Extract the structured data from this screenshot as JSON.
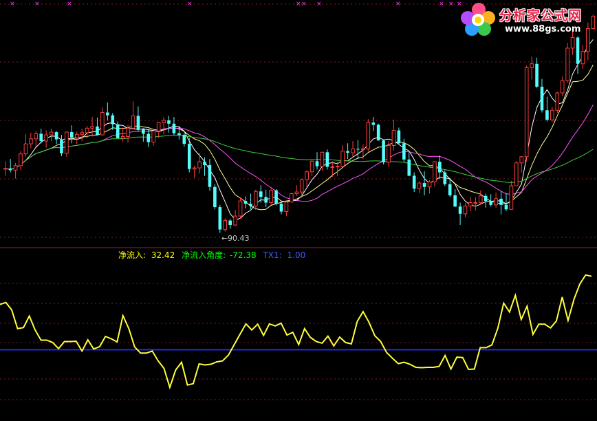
{
  "logo": {
    "title": "分析家公式网",
    "url": "www.88gs.com"
  },
  "annotations": {
    "low_marker": "←90.43"
  },
  "legend": {
    "flow_label": "净流入:",
    "flow_value": "32.42",
    "angle_label": "净流入角度:",
    "angle_value": "-72.38",
    "tx_label": "TX1:",
    "tx_value": "1.00"
  },
  "colors": {
    "background": "#000000",
    "up_candle": "#ff3c3c",
    "down_candle": "#54fcfc",
    "ma5": "#ffffff",
    "ma10": "#ffff9a",
    "ma20": "#ff55ff",
    "ma60": "#3cd23c",
    "osc_line": "#ffff3c",
    "baseline": "#2828ff",
    "grid": "#8a1c1c",
    "flow_label": "#ffff00",
    "angle_label": "#00ff00",
    "tx_label": "#3c5cff"
  },
  "chart_data": [
    {
      "type": "candlestick",
      "title": "",
      "xlabel": "",
      "ylabel": "",
      "ylim": [
        88,
        132
      ],
      "grid": true,
      "annotation_low": 90.43,
      "ohlc": [
        [
          101.8,
          103.2,
          100.6,
          101.9
        ],
        [
          101.9,
          103.6,
          101.2,
          101.6
        ],
        [
          101.6,
          102.9,
          100.1,
          102.4
        ],
        [
          102.4,
          105.0,
          101.6,
          104.5
        ],
        [
          104.5,
          108.0,
          104.0,
          106.3
        ],
        [
          106.3,
          108.3,
          105.5,
          107.2
        ],
        [
          107.2,
          108.6,
          105.8,
          108.1
        ],
        [
          108.1,
          109.0,
          106.4,
          106.8
        ],
        [
          106.8,
          108.7,
          105.6,
          107.9
        ],
        [
          107.9,
          109.0,
          106.8,
          108.4
        ],
        [
          108.4,
          108.6,
          106.3,
          107.1
        ],
        [
          107.1,
          107.9,
          104.1,
          104.6
        ],
        [
          104.6,
          108.5,
          104.0,
          108.4
        ],
        [
          108.4,
          109.6,
          106.4,
          107.4
        ],
        [
          107.4,
          108.5,
          106.3,
          108.0
        ],
        [
          108.0,
          109.0,
          106.8,
          108.3
        ],
        [
          108.3,
          109.5,
          107.3,
          109.1
        ],
        [
          109.1,
          111.1,
          107.6,
          109.4
        ],
        [
          109.4,
          111.0,
          107.8,
          107.9
        ],
        [
          107.9,
          112.8,
          107.8,
          111.9
        ],
        [
          111.9,
          113.7,
          110.5,
          111.4
        ],
        [
          111.4,
          111.8,
          108.8,
          109.8
        ],
        [
          109.8,
          110.3,
          107.3,
          107.3
        ],
        [
          107.3,
          109.2,
          106.7,
          107.6
        ],
        [
          107.6,
          109.7,
          106.5,
          109.1
        ],
        [
          109.1,
          113.9,
          108.9,
          111.3
        ],
        [
          111.3,
          113.0,
          108.5,
          108.9
        ],
        [
          108.9,
          109.1,
          106.7,
          108.1
        ],
        [
          108.1,
          109.0,
          105.7,
          106.6
        ],
        [
          106.6,
          108.6,
          106.0,
          108.6
        ],
        [
          108.6,
          110.2,
          107.3,
          110.1
        ],
        [
          110.1,
          111.1,
          108.0,
          110.5
        ],
        [
          110.5,
          111.3,
          108.3,
          109.9
        ],
        [
          109.9,
          111.1,
          107.9,
          108.2
        ],
        [
          108.2,
          109.5,
          107.1,
          107.9
        ],
        [
          107.9,
          108.2,
          105.8,
          106.3
        ],
        [
          106.3,
          107.3,
          101.2,
          101.8
        ],
        [
          101.8,
          102.4,
          100.2,
          102.0
        ],
        [
          102.0,
          104.6,
          101.0,
          103.1
        ],
        [
          103.1,
          103.9,
          100.6,
          102.5
        ],
        [
          102.5,
          103.6,
          97.9,
          98.6
        ],
        [
          98.6,
          99.1,
          94.6,
          95.0
        ],
        [
          95.0,
          95.4,
          90.4,
          91.0
        ],
        [
          91.0,
          93.0,
          90.6,
          92.6
        ],
        [
          92.6,
          92.9,
          91.1,
          91.8
        ],
        [
          91.8,
          94.5,
          91.6,
          93.4
        ],
        [
          93.4,
          96.6,
          92.9,
          96.1
        ],
        [
          96.1,
          96.9,
          94.8,
          95.6
        ],
        [
          95.6,
          97.4,
          94.6,
          95.2
        ],
        [
          95.2,
          98.1,
          94.5,
          97.8
        ],
        [
          97.8,
          98.9,
          95.8,
          96.8
        ],
        [
          96.8,
          98.1,
          95.0,
          95.8
        ],
        [
          95.8,
          98.6,
          95.4,
          98.0
        ],
        [
          98.0,
          98.2,
          95.3,
          95.6
        ],
        [
          95.6,
          96.0,
          93.7,
          94.2
        ],
        [
          94.2,
          95.9,
          93.4,
          95.9
        ],
        [
          95.9,
          97.6,
          95.8,
          97.4
        ],
        [
          97.4,
          98.9,
          97.0,
          97.7
        ],
        [
          97.7,
          100.0,
          96.7,
          99.9
        ],
        [
          99.9,
          101.6,
          98.6,
          101.3
        ],
        [
          101.3,
          103.4,
          100.5,
          103.2
        ],
        [
          103.2,
          104.8,
          101.7,
          102.3
        ],
        [
          102.3,
          104.9,
          101.5,
          104.8
        ],
        [
          104.8,
          105.3,
          101.7,
          102.2
        ],
        [
          102.2,
          103.2,
          100.4,
          102.2
        ],
        [
          102.2,
          103.0,
          100.5,
          102.3
        ],
        [
          102.3,
          106.1,
          102.2,
          105.0
        ],
        [
          105.0,
          106.4,
          103.6,
          104.7
        ],
        [
          104.7,
          106.8,
          104.0,
          105.4
        ],
        [
          105.4,
          107.0,
          103.6,
          105.3
        ],
        [
          105.3,
          106.2,
          103.6,
          105.4
        ],
        [
          105.4,
          110.7,
          104.9,
          110.1
        ],
        [
          110.1,
          111.1,
          108.6,
          109.7
        ],
        [
          109.7,
          109.9,
          106.9,
          106.9
        ],
        [
          106.9,
          107.0,
          102.6,
          103.0
        ],
        [
          103.0,
          106.8,
          102.2,
          106.0
        ],
        [
          106.0,
          110.6,
          105.1,
          108.7
        ],
        [
          108.7,
          109.2,
          106.2,
          106.4
        ],
        [
          106.4,
          107.2,
          103.1,
          103.5
        ],
        [
          103.5,
          104.8,
          100.5,
          100.6
        ],
        [
          100.6,
          101.2,
          97.7,
          98.3
        ],
        [
          98.3,
          99.6,
          97.5,
          99.3
        ],
        [
          99.3,
          101.4,
          97.1,
          98.6
        ],
        [
          98.6,
          99.8,
          97.4,
          99.5
        ],
        [
          99.5,
          103.2,
          98.7,
          103.1
        ],
        [
          103.1,
          104.2,
          100.0,
          101.2
        ],
        [
          101.2,
          101.6,
          98.8,
          99.1
        ],
        [
          99.1,
          100.2,
          96.8,
          97.1
        ],
        [
          97.1,
          98.2,
          95.0,
          95.1
        ],
        [
          95.1,
          95.8,
          91.8,
          93.8
        ],
        [
          93.8,
          95.7,
          93.2,
          95.2
        ],
        [
          95.2,
          96.8,
          94.3,
          95.8
        ],
        [
          95.8,
          96.8,
          94.4,
          95.8
        ],
        [
          95.8,
          98.0,
          95.4,
          97.0
        ],
        [
          97.0,
          97.4,
          94.9,
          96.1
        ],
        [
          96.1,
          97.3,
          95.1,
          95.4
        ],
        [
          95.4,
          97.6,
          94.9,
          96.5
        ],
        [
          96.5,
          97.8,
          93.7,
          95.4
        ],
        [
          95.4,
          97.5,
          94.3,
          94.6
        ],
        [
          94.6,
          99.7,
          94.6,
          98.8
        ],
        [
          98.8,
          103.2,
          98.8,
          102.9
        ],
        [
          102.9,
          104.1,
          101.2,
          104.0
        ],
        [
          104.0,
          120.3,
          103.1,
          119.9
        ],
        [
          119.9,
          121.9,
          117.8,
          120.6
        ],
        [
          120.6,
          121.7,
          116.3,
          116.5
        ],
        [
          116.5,
          117.9,
          111.9,
          112.3
        ],
        [
          112.3,
          114.7,
          110.3,
          110.6
        ],
        [
          110.6,
          112.9,
          110.2,
          112.3
        ],
        [
          112.3,
          115.6,
          111.8,
          115.4
        ],
        [
          115.4,
          118.3,
          114.8,
          117.6
        ],
        [
          117.6,
          124.3,
          117.2,
          123.4
        ],
        [
          123.4,
          126.8,
          122.2,
          125.3
        ],
        [
          125.3,
          125.5,
          118.8,
          120.6
        ],
        [
          120.6,
          123.9,
          119.7,
          122.8
        ],
        [
          122.8,
          128.0,
          121.2,
          126.9
        ],
        [
          126.9,
          129.4,
          126.7,
          129.1
        ]
      ]
    },
    {
      "type": "line",
      "title": "",
      "xlabel": "",
      "ylabel": "",
      "ylim": [
        -20,
        28
      ],
      "grid": true,
      "series": [
        {
          "name": "净流入",
          "values": [
            14.3,
            14.9,
            12.7,
            7.2,
            7.5,
            10.9,
            6.8,
            3.8,
            3.8,
            3.1,
            1.3,
            3.4,
            3.4,
            3.5,
            0.6,
            3.9,
            1.2,
            1.9,
            4.9,
            4.2,
            3.3,
            11.0,
            7.2,
            1.8,
            0.0,
            0.0,
            0.6,
            -2.3,
            -4.5,
            -10.1,
            -5.0,
            -2.7,
            -9.4,
            -9.0,
            -3.2,
            -3.5,
            -3.3,
            -2.6,
            -2.3,
            -0.6,
            2.5,
            5.6,
            8.6,
            6.8,
            8.5,
            5.2,
            8.6,
            8.0,
            8.8,
            5.3,
            6.1,
            2.5,
            7.2,
            4.6,
            3.4,
            2.9,
            5.0,
            2.1,
            4.7,
            3.1,
            2.7,
            9.3,
            12.2,
            9.1,
            5.1,
            3.4,
            0.2,
            -1.5,
            -3.1,
            -2.7,
            -3.3,
            -4.2,
            -4.3,
            -4.2,
            -4.2,
            -3.9,
            -0.7,
            -4.7,
            -1.2,
            -1.3,
            -4.8,
            -4.7,
            1.6,
            1.6,
            2.4,
            7.3,
            14.7,
            12.1,
            17.0,
            9.9,
            13.8,
            5.5,
            8.5,
            8.5,
            7.4,
            9.4,
            16.5,
            9.6,
            15.8,
            20.3,
            23.0,
            22.6
          ]
        },
        {
          "name": "TX1",
          "values": [
            1.0,
            1.0
          ]
        }
      ]
    }
  ]
}
